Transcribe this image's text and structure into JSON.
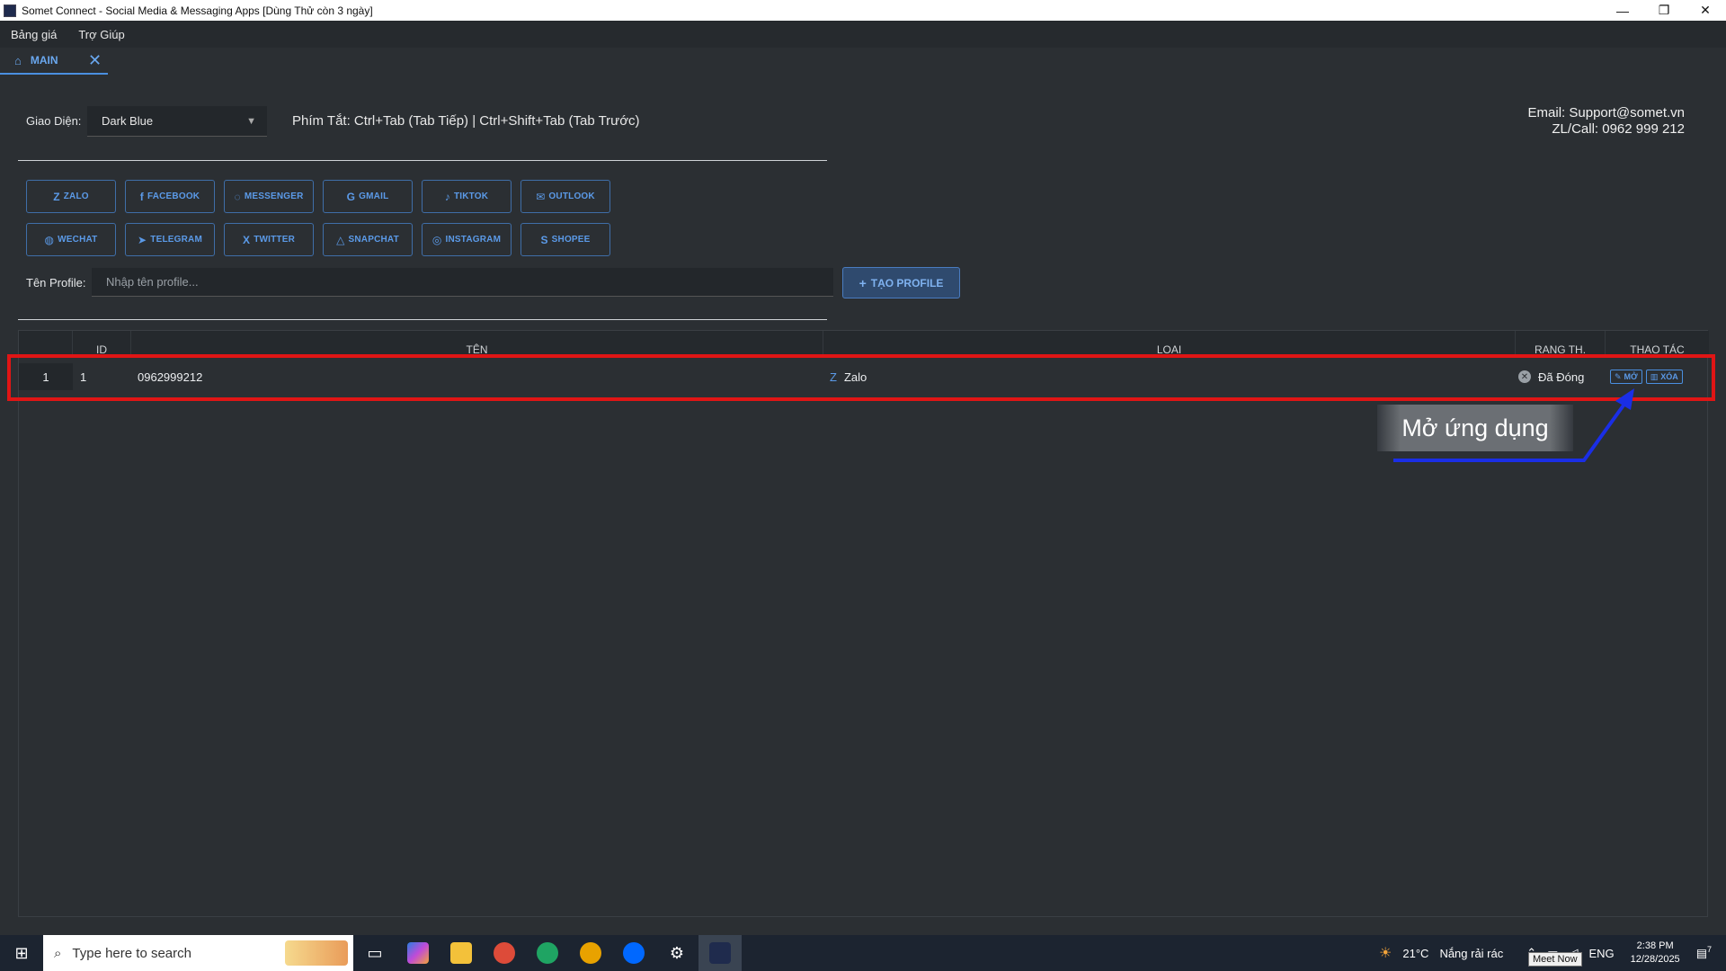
{
  "window": {
    "title": "Somet Connect - Social Media & Messaging Apps [Dùng Thử còn 3 ngày]",
    "minimize": "—",
    "restore": "❐",
    "close": "✕"
  },
  "menu": {
    "items": [
      "Bảng giá",
      "Trợ Giúp"
    ]
  },
  "tab": {
    "label": "MAIN",
    "home_glyph": "⌂",
    "close_glyph": "✕"
  },
  "settings": {
    "theme_label": "Giao Diện:",
    "theme_value": "Dark Blue",
    "caret": "▼",
    "shortcut_text": "Phím Tắt: Ctrl+Tab (Tab Tiếp) | Ctrl+Shift+Tab (Tab Trước)"
  },
  "contact": {
    "email": "Email: Support@somet.vn",
    "phone": "ZL/Call: 0962 999 212"
  },
  "apps": {
    "row1": [
      {
        "label": "ZALO",
        "glyph": "Z"
      },
      {
        "label": "FACEBOOK",
        "glyph": "f"
      },
      {
        "label": "MESSENGER",
        "glyph": "◌"
      },
      {
        "label": "GMAIL",
        "glyph": "G"
      },
      {
        "label": "TIKTOK",
        "glyph": "♪"
      },
      {
        "label": "OUTLOOK",
        "glyph": "✉"
      }
    ],
    "row2": [
      {
        "label": "WECHAT",
        "glyph": "◍"
      },
      {
        "label": "TELEGRAM",
        "glyph": "➤"
      },
      {
        "label": "TWITTER",
        "glyph": "X"
      },
      {
        "label": "SNAPCHAT",
        "glyph": "△"
      },
      {
        "label": "INSTAGRAM",
        "glyph": "◎"
      },
      {
        "label": "SHOPEE",
        "glyph": "S"
      }
    ]
  },
  "profile": {
    "label": "Tên Profile:",
    "placeholder": "Nhập tên profile...",
    "create_label": "TẠO PROFILE",
    "create_glyph": "+"
  },
  "table": {
    "headers": {
      "id": "ID",
      "name": "TÊN",
      "type": "LOẠI",
      "status": "RANG TH.",
      "actions": "THAO TÁC"
    },
    "rows": [
      {
        "index": "1",
        "id": "1",
        "name": "0962999212",
        "type_glyph": "Z",
        "type": "Zalo",
        "status_glyph": "✕",
        "status": "Đã Đóng",
        "open_label": "MỞ",
        "delete_label": "XÓA"
      }
    ]
  },
  "annotation": {
    "callout": "Mở ứng dụng",
    "colors": {
      "box": "#e01515",
      "arrow": "#1a2ee6"
    }
  },
  "taskbar": {
    "search_placeholder": "Type here to search",
    "weather_temp": "21°C",
    "weather_text": "Nắng rải rác",
    "language": "ENG",
    "time": "2:38 PM",
    "date": "12/28/2025",
    "meet_now": "Meet Now",
    "notifications": "7"
  }
}
